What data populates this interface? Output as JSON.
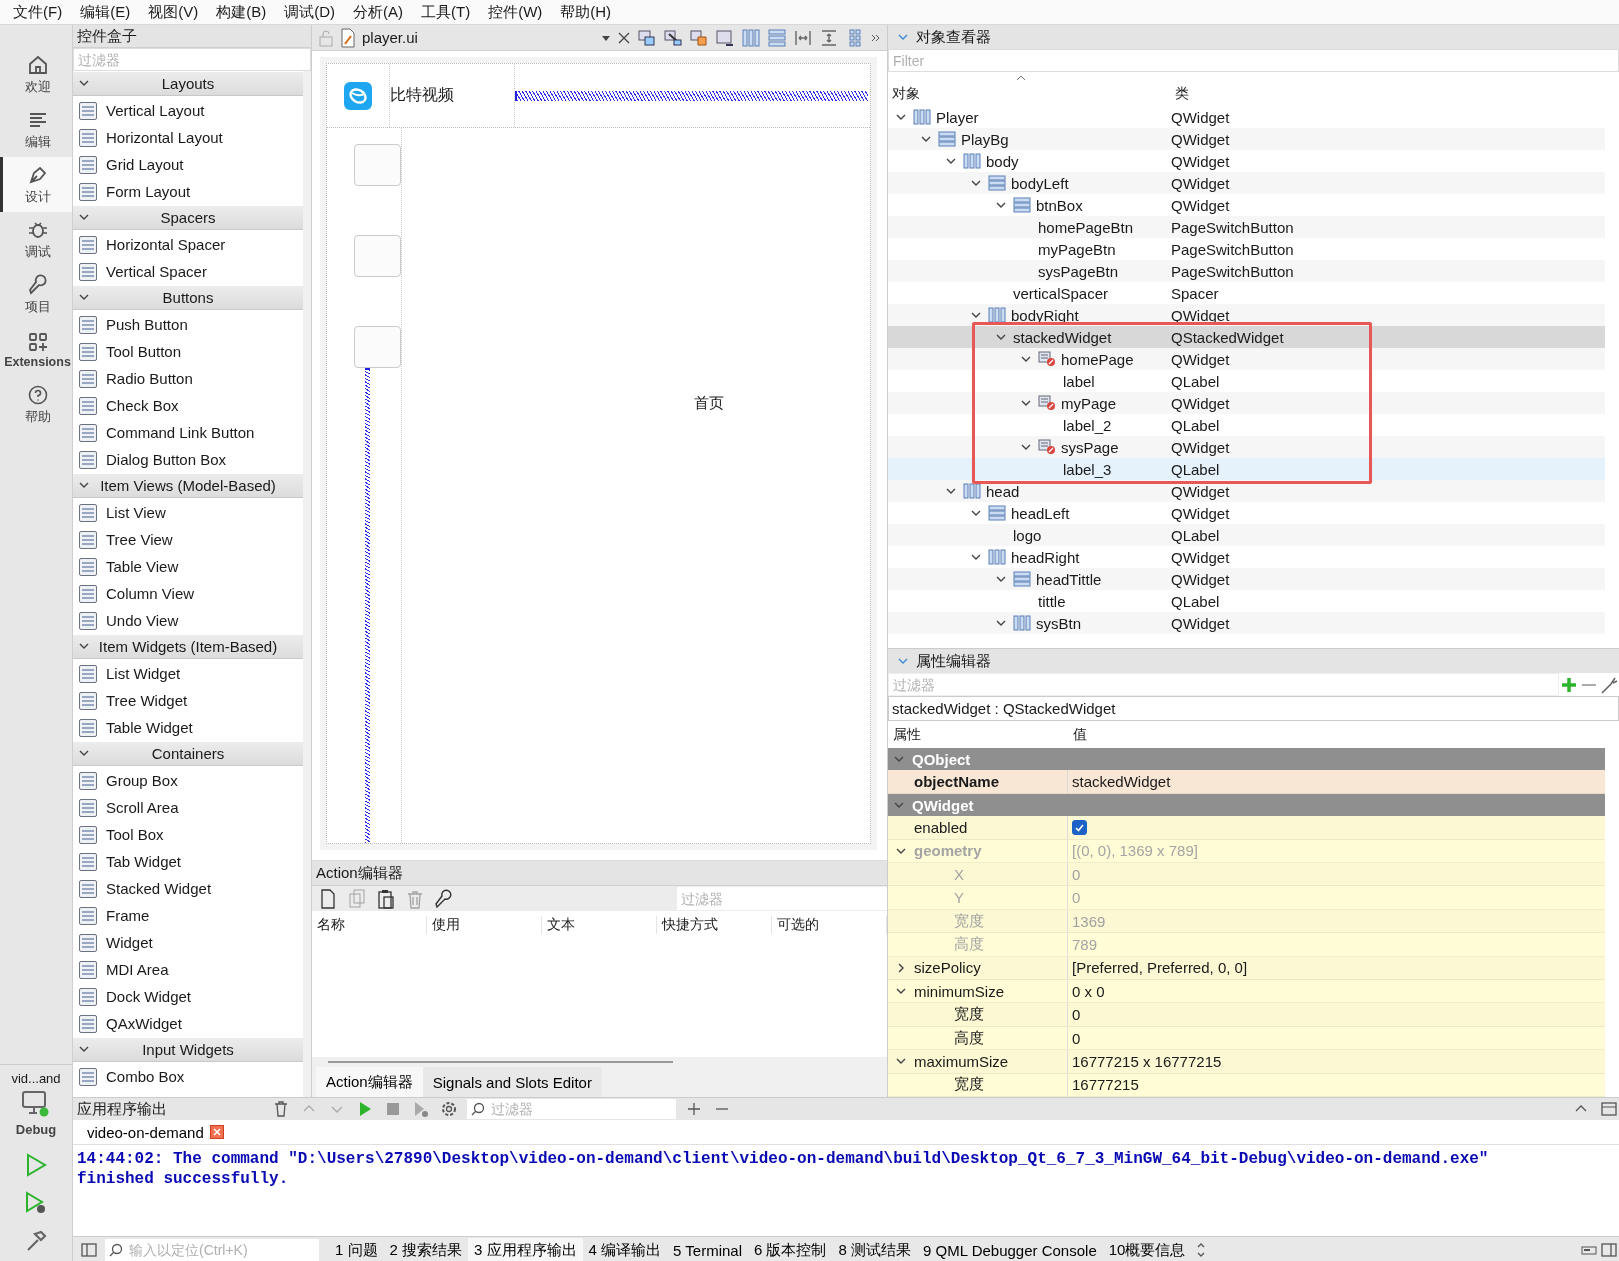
{
  "menu": [
    "文件(F)",
    "编辑(E)",
    "视图(V)",
    "构建(B)",
    "调试(D)",
    "分析(A)",
    "工具(T)",
    "控件(W)",
    "帮助(H)"
  ],
  "mode_bar": {
    "items": [
      {
        "label": "欢迎",
        "kind": "home",
        "selected": false
      },
      {
        "label": "编辑",
        "kind": "edit",
        "selected": false
      },
      {
        "label": "设计",
        "kind": "design",
        "selected": true
      },
      {
        "label": "调试",
        "kind": "debug",
        "selected": false
      },
      {
        "label": "项目",
        "kind": "project",
        "selected": false
      },
      {
        "label": "Extensions",
        "kind": "extensions",
        "selected": false
      },
      {
        "label": "帮助",
        "kind": "help",
        "selected": false
      }
    ],
    "project": "vid...and",
    "build_config": "Debug"
  },
  "widget_box": {
    "title": "控件盒子",
    "filter": {
      "placeholder": "过滤器"
    },
    "categories": [
      {
        "name": "Layouts",
        "expanded": true,
        "items": [
          "Vertical Layout",
          "Horizontal Layout",
          "Grid Layout",
          "Form Layout"
        ]
      },
      {
        "name": "Spacers",
        "expanded": true,
        "items": [
          "Horizontal Spacer",
          "Vertical Spacer"
        ]
      },
      {
        "name": "Buttons",
        "expanded": true,
        "items": [
          "Push Button",
          "Tool Button",
          "Radio Button",
          "Check Box",
          "Command Link Button",
          "Dialog Button Box"
        ]
      },
      {
        "name": "Item Views (Model-Based)",
        "expanded": true,
        "items": [
          "List View",
          "Tree View",
          "Table View",
          "Column View",
          "Undo View"
        ]
      },
      {
        "name": "Item Widgets (Item-Based)",
        "expanded": true,
        "items": [
          "List Widget",
          "Tree Widget",
          "Table Widget"
        ]
      },
      {
        "name": "Containers",
        "expanded": true,
        "items": [
          "Group Box",
          "Scroll Area",
          "Tool Box",
          "Tab Widget",
          "Stacked Widget",
          "Frame",
          "Widget",
          "MDI Area",
          "Dock Widget",
          "QAxWidget"
        ]
      },
      {
        "name": "Input Widgets",
        "expanded": true,
        "items": [
          "Combo Box"
        ]
      }
    ]
  },
  "designer": {
    "file": "player.ui",
    "form": {
      "title": "比特视频",
      "page_label": "首页"
    }
  },
  "action_editor": {
    "title": "Action编辑器",
    "filter": {
      "placeholder": "过滤器"
    },
    "columns": [
      "名称",
      "使用",
      "文本",
      "快捷方式",
      "可选的"
    ],
    "tabs": [
      {
        "label": "Action编辑器",
        "selected": true
      },
      {
        "label": "Signals and Slots Editor",
        "selected": false
      }
    ]
  },
  "object_inspector": {
    "title": "对象查看器",
    "filter": {
      "placeholder": "Filter"
    },
    "columns": [
      "对象",
      "类"
    ],
    "tree": [
      {
        "name": "Player",
        "class": "QWidget",
        "kind": "hbox",
        "expanded": true,
        "selected": false,
        "hovered": false,
        "children": [
          {
            "name": "PlayBg",
            "class": "QWidget",
            "kind": "vbox",
            "expanded": true,
            "selected": false,
            "hovered": false,
            "children": [
              {
                "name": "body",
                "class": "QWidget",
                "kind": "hbox",
                "expanded": true,
                "selected": false,
                "hovered": false,
                "children": [
                  {
                    "name": "bodyLeft",
                    "class": "QWidget",
                    "kind": "vbox",
                    "expanded": true,
                    "selected": false,
                    "hovered": false,
                    "children": [
                      {
                        "name": "btnBox",
                        "class": "QWidget",
                        "kind": "vbox",
                        "expanded": true,
                        "selected": false,
                        "hovered": false,
                        "children": [
                          {
                            "name": "homePageBtn",
                            "class": "PageSwitchButton",
                            "selected": false,
                            "hovered": false
                          },
                          {
                            "name": "myPageBtn",
                            "class": "PageSwitchButton",
                            "selected": false,
                            "hovered": false
                          },
                          {
                            "name": "sysPageBtn",
                            "class": "PageSwitchButton",
                            "selected": false,
                            "hovered": false
                          }
                        ]
                      },
                      {
                        "name": "verticalSpacer",
                        "class": "Spacer",
                        "selected": false,
                        "hovered": false
                      }
                    ]
                  },
                  {
                    "name": "bodyRight",
                    "class": "QWidget",
                    "kind": "hbox",
                    "expanded": true,
                    "selected": false,
                    "hovered": false,
                    "children": [
                      {
                        "name": "stackedWidget",
                        "class": "QStackedWidget",
                        "expanded": true,
                        "selected": true,
                        "hovered": false,
                        "children": [
                          {
                            "name": "homePage",
                            "class": "QWidget",
                            "kind": "page",
                            "expanded": true,
                            "selected": false,
                            "hovered": false,
                            "children": [
                              {
                                "name": "label",
                                "class": "QLabel",
                                "selected": false,
                                "hovered": false
                              }
                            ]
                          },
                          {
                            "name": "myPage",
                            "class": "QWidget",
                            "kind": "page",
                            "expanded": true,
                            "selected": false,
                            "hovered": false,
                            "children": [
                              {
                                "name": "label_2",
                                "class": "QLabel",
                                "selected": false,
                                "hovered": false
                              }
                            ]
                          },
                          {
                            "name": "sysPage",
                            "class": "QWidget",
                            "kind": "page",
                            "expanded": true,
                            "selected": false,
                            "hovered": false,
                            "children": [
                              {
                                "name": "label_3",
                                "class": "QLabel",
                                "selected": false,
                                "hovered": true
                              }
                            ]
                          }
                        ]
                      }
                    ]
                  }
                ]
              },
              {
                "name": "head",
                "class": "QWidget",
                "kind": "hbox",
                "expanded": true,
                "selected": false,
                "hovered": false,
                "children": [
                  {
                    "name": "headLeft",
                    "class": "QWidget",
                    "kind": "vbox",
                    "expanded": true,
                    "selected": false,
                    "hovered": false,
                    "children": [
                      {
                        "name": "logo",
                        "class": "QLabel",
                        "selected": false,
                        "hovered": false
                      }
                    ]
                  },
                  {
                    "name": "headRight",
                    "class": "QWidget",
                    "kind": "hbox",
                    "expanded": true,
                    "selected": false,
                    "hovered": false,
                    "children": [
                      {
                        "name": "headTittle",
                        "class": "QWidget",
                        "kind": "vbox",
                        "expanded": true,
                        "selected": false,
                        "hovered": false,
                        "children": [
                          {
                            "name": "tittle",
                            "class": "QLabel",
                            "selected": false,
                            "hovered": false
                          }
                        ]
                      },
                      {
                        "name": "sysBtn",
                        "class": "QWidget",
                        "kind": "hbox",
                        "expanded": true,
                        "selected": false,
                        "hovered": false
                      }
                    ]
                  }
                ]
              }
            ]
          }
        ]
      }
    ]
  },
  "property_editor": {
    "title": "属性编辑器",
    "filter": {
      "placeholder": "过滤器"
    },
    "object": "stackedWidget : QStackedWidget",
    "columns": [
      "属性",
      "值"
    ],
    "groups": [
      {
        "name": "QObject",
        "color": "#fdebd8",
        "expanded": true,
        "rows": [
          {
            "name": "objectName",
            "value": "stackedWidget",
            "kind": "text",
            "modified": true,
            "disabled": false
          }
        ]
      },
      {
        "name": "QWidget",
        "color": "#fffcd6",
        "expanded": true,
        "rows": [
          {
            "name": "enabled",
            "kind": "checkbox",
            "checked": true,
            "modified": false,
            "disabled": false
          },
          {
            "name": "geometry",
            "value": "[(0, 0), 1369 x 789]",
            "kind": "text",
            "modified": true,
            "disabled": true,
            "expanded": true,
            "children": [
              {
                "name": "X",
                "value": "0",
                "kind": "text",
                "modified": false,
                "disabled": true
              },
              {
                "name": "Y",
                "value": "0",
                "kind": "text",
                "modified": false,
                "disabled": true
              },
              {
                "name": "宽度",
                "value": "1369",
                "kind": "text",
                "modified": false,
                "disabled": true
              },
              {
                "name": "高度",
                "value": "789",
                "kind": "text",
                "modified": false,
                "disabled": true
              }
            ]
          },
          {
            "name": "sizePolicy",
            "value": "[Preferred, Preferred, 0, 0]",
            "kind": "text",
            "modified": false,
            "disabled": false,
            "expanded": false
          },
          {
            "name": "minimumSize",
            "value": "0 x 0",
            "kind": "text",
            "modified": false,
            "disabled": false,
            "expanded": true,
            "children": [
              {
                "name": "宽度",
                "value": "0",
                "kind": "text",
                "modified": false,
                "disabled": false
              },
              {
                "name": "高度",
                "value": "0",
                "kind": "text",
                "modified": false,
                "disabled": false
              }
            ]
          },
          {
            "name": "maximumSize",
            "value": "16777215 x 16777215",
            "kind": "text",
            "modified": false,
            "disabled": false,
            "expanded": true,
            "children": [
              {
                "name": "宽度",
                "value": "16777215",
                "kind": "text",
                "modified": false,
                "disabled": false
              }
            ]
          }
        ]
      }
    ]
  },
  "output": {
    "title": "应用程序输出",
    "filter": {
      "placeholder": "过滤器"
    },
    "tabs": [
      {
        "label": "video-on-demand",
        "selected": true
      }
    ],
    "lines": [
      "14:44:02: The command \"D:\\Users\\27890\\Desktop\\video-on-demand\\client\\video-on-demand\\build\\Desktop_Qt_6_7_3_MinGW_64_bit-Debug\\video-on-demand.exe\"",
      "finished successfully."
    ]
  },
  "status_bar": {
    "locator": {
      "placeholder": "输入以定位(Ctrl+K)"
    },
    "tabs": [
      {
        "label": "1 问题",
        "selected": false
      },
      {
        "label": "2 搜索结果",
        "selected": false
      },
      {
        "label": "3 应用程序输出",
        "selected": true
      },
      {
        "label": "4 编译输出",
        "selected": false
      },
      {
        "label": "5 Terminal",
        "selected": false
      },
      {
        "label": "6 版本控制",
        "selected": false
      },
      {
        "label": "8 测试结果",
        "selected": false
      },
      {
        "label": "9 QML Debugger Console",
        "selected": false
      },
      {
        "label": "10概要信息",
        "selected": false
      }
    ]
  }
}
